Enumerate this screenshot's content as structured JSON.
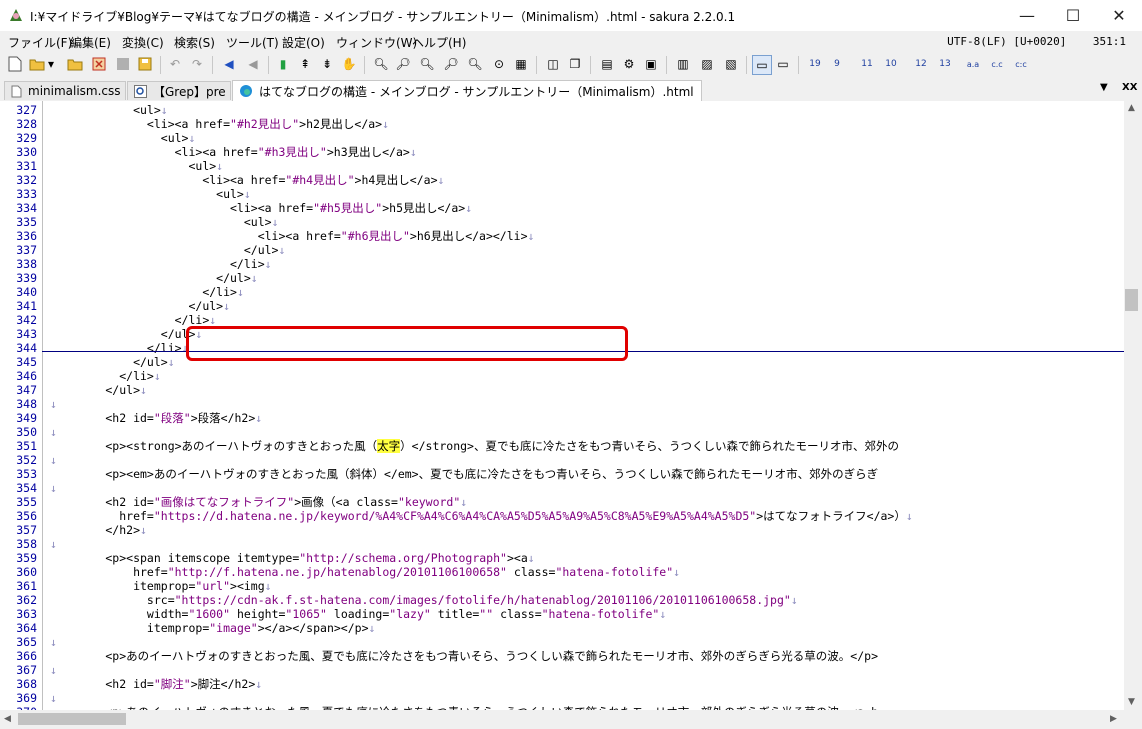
{
  "window": {
    "title": "I:¥マイドライブ¥Blog¥テーマ¥はてなブログの構造 - メインブログ - サンプルエントリー（Minimalism）.html - sakura 2.2.0.1",
    "controls": {
      "minimize": "—",
      "maximize": "☐",
      "close": "✕"
    }
  },
  "menu": [
    "ファイル(F)",
    "編集(E)",
    "変換(C)",
    "検索(S)",
    "ツール(T)",
    "設定(O)",
    "ウィンドウ(W)",
    "ヘルプ(H)"
  ],
  "status": {
    "encoding": "UTF-8(LF) [U+0020]",
    "position": "351:1"
  },
  "tabs": [
    {
      "label": "minimalism.css",
      "icon": "document-icon"
    },
    {
      "label": "【Grep】pre",
      "icon": "grep-icon"
    },
    {
      "label": "はてなブログの構造 - メインブログ - サンプルエントリー（Minimalism）.html",
      "icon": "edge-icon"
    }
  ],
  "tab_controls": {
    "dropdown": "▼",
    "close": "XX"
  },
  "editor": {
    "lines": [
      {
        "n": "327",
        "text": "            <ul>↓"
      },
      {
        "n": "328",
        "text": "              <li><a href=\"#h2見出し\">h2見出し</a>↓"
      },
      {
        "n": "329",
        "text": "                <ul>↓"
      },
      {
        "n": "330",
        "text": "                  <li><a href=\"#h3見出し\">h3見出し</a>↓"
      },
      {
        "n": "331",
        "text": "                    <ul>↓"
      },
      {
        "n": "332",
        "text": "                      <li><a href=\"#h4見出し\">h4見出し</a>↓"
      },
      {
        "n": "333",
        "text": "                        <ul>↓"
      },
      {
        "n": "334",
        "text": "                          <li><a href=\"#h5見出し\">h5見出し</a>↓"
      },
      {
        "n": "335",
        "text": "                            <ul>↓"
      },
      {
        "n": "336",
        "text": "                              <li><a href=\"#h6見出し\">h6見出し</a></li>↓"
      },
      {
        "n": "337",
        "text": "                            </ul>↓"
      },
      {
        "n": "338",
        "text": "                          </li>↓"
      },
      {
        "n": "339",
        "text": "                        </ul>↓"
      },
      {
        "n": "340",
        "text": "                      </li>↓"
      },
      {
        "n": "341",
        "text": "                    </ul>↓"
      },
      {
        "n": "342",
        "text": "                  </li>↓"
      },
      {
        "n": "343",
        "text": "                </ul>↓"
      },
      {
        "n": "344",
        "text": "              </li>↓"
      },
      {
        "n": "345",
        "text": "            </ul>↓"
      },
      {
        "n": "346",
        "text": "          </li>↓"
      },
      {
        "n": "347",
        "text": "        </ul>↓"
      },
      {
        "n": "348",
        "text": "↓"
      },
      {
        "n": "349",
        "text": "        <h2 id=\"段落\">段落</h2>↓"
      },
      {
        "n": "350",
        "text": "↓"
      },
      {
        "n": "351",
        "text": "        <p><strong>あのイーハトヴォのすきとおった風（太字）</strong>、夏でも底に冷たさをもつ青いそら、うつくしい森で飾られたモーリオ市、郊外の"
      },
      {
        "n": "352",
        "text": "↓"
      },
      {
        "n": "353",
        "text": "        <p><em>あのイーハトヴォのすきとおった風（斜体）</em>、夏でも底に冷たさをもつ青いそら、うつくしい森で飾られたモーリオ市、郊外のぎらぎ"
      },
      {
        "n": "354",
        "text": "↓"
      },
      {
        "n": "355",
        "text": "        <h2 id=\"画像はてなフォトライフ\">画像（<a class=\"keyword\"↓"
      },
      {
        "n": "356",
        "text": "          href=\"https://d.hatena.ne.jp/keyword/%A4%CF%A4%C6%A4%CA%A5%D5%A5%A9%A5%C8%A5%E9%A5%A4%A5%D5\">はてなフォトライフ</a>）↓"
      },
      {
        "n": "357",
        "text": "        </h2>↓"
      },
      {
        "n": "358",
        "text": "↓"
      },
      {
        "n": "359",
        "text": "        <p><span itemscope itemtype=\"http://schema.org/Photograph\"><a↓"
      },
      {
        "n": "360",
        "text": "            href=\"http://f.hatena.ne.jp/hatenablog/20101106100658\" class=\"hatena-fotolife\"↓"
      },
      {
        "n": "361",
        "text": "            itemprop=\"url\"><img↓"
      },
      {
        "n": "362",
        "text": "              src=\"https://cdn-ak.f.st-hatena.com/images/fotolife/h/hatenablog/20101106/20101106100658.jpg\"↓"
      },
      {
        "n": "363",
        "text": "              width=\"1600\" height=\"1065\" loading=\"lazy\" title=\"\" class=\"hatena-fotolife\"↓"
      },
      {
        "n": "364",
        "text": "              itemprop=\"image\"></a></span></p>↓"
      },
      {
        "n": "365",
        "text": "↓"
      },
      {
        "n": "366",
        "text": "        <p>あのイーハトヴォのすきとおった風、夏でも底に冷たさをもつ青いそら、うつくしい森で飾られたモーリオ市、郊外のぎらぎら光る草の波。</p>"
      },
      {
        "n": "367",
        "text": "↓"
      },
      {
        "n": "368",
        "text": "        <h2 id=\"脚注\">脚注</h2>↓"
      },
      {
        "n": "369",
        "text": "↓"
      },
      {
        "n": "370",
        "text": "        <p>あのイーハトヴォのすきとおった風、夏でも底に冷たさをもつ青いそら、うつくしい森で飾られたモーリオ市、郊外のぎらぎら光る草の波。<a h"
      }
    ]
  },
  "colors": {
    "callout": "#e00000",
    "line_numbers": "#0000a0",
    "attr_string": "#800080",
    "highlight": "#ffff40"
  }
}
